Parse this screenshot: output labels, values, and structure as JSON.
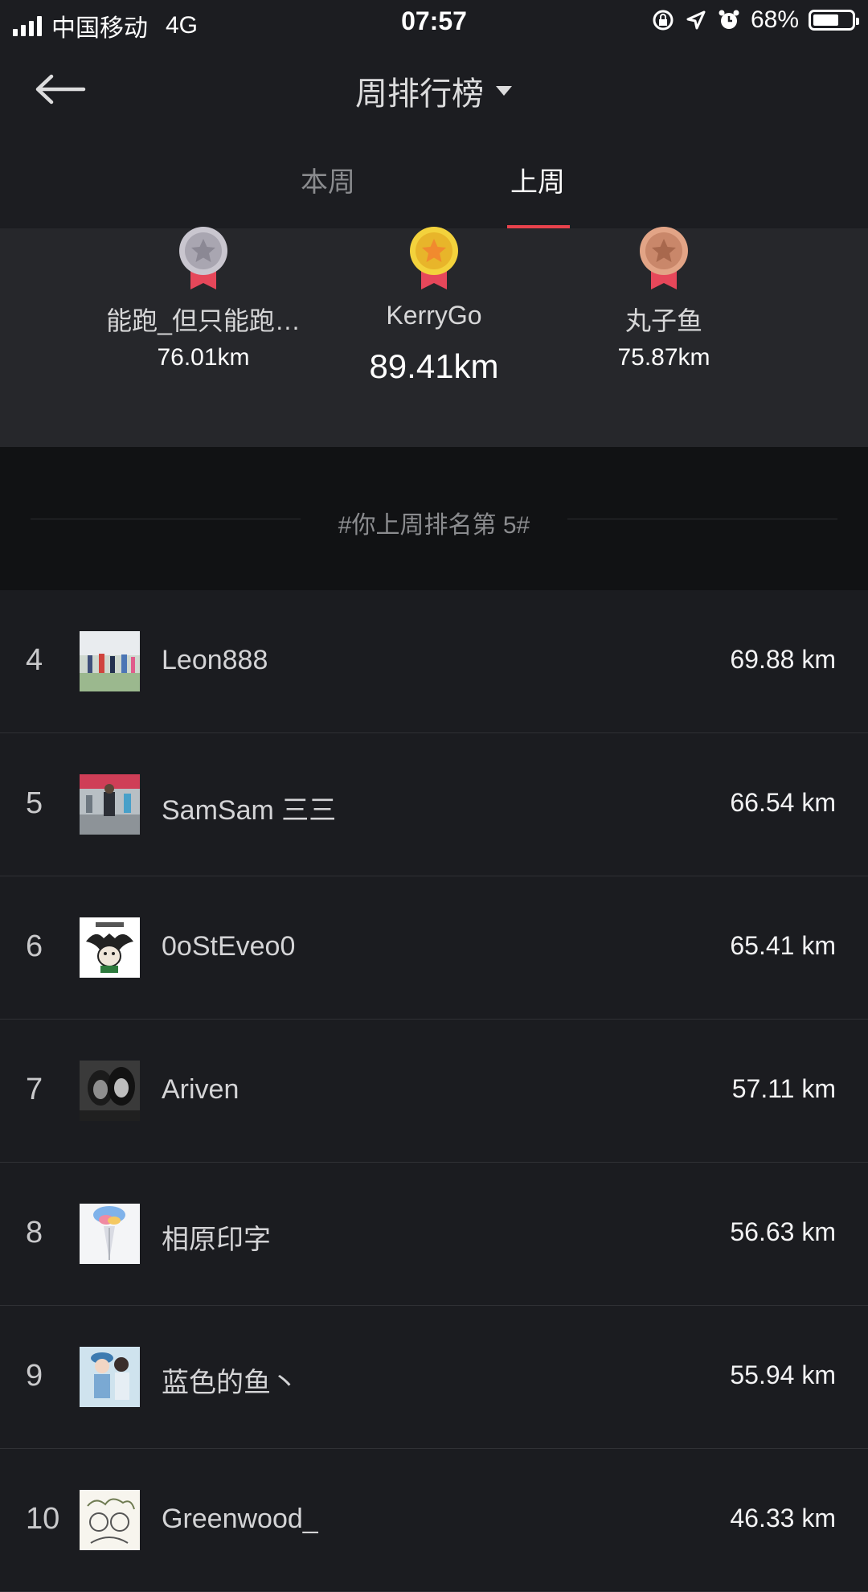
{
  "status_bar": {
    "carrier": "中国移动",
    "network": "4G",
    "time": "07:57",
    "battery": "68%",
    "battery_level": 0.68,
    "icons": [
      "signal-icon",
      "orientation-lock-icon",
      "location-icon",
      "alarm-icon",
      "battery-icon"
    ]
  },
  "header": {
    "title": "周排行榜",
    "back_icon": "arrow-left-icon",
    "dropdown_icon": "caret-down-icon"
  },
  "tabs": [
    {
      "label": "本周",
      "active": false
    },
    {
      "label": "上周",
      "active": true
    }
  ],
  "accent_color": "#e8424c",
  "podium": {
    "first": {
      "name": "KerryGo",
      "distance": "89.41km",
      "medal": "gold-medal-icon"
    },
    "second": {
      "name": "能跑_但只能跑…",
      "distance": "76.01km",
      "medal": "silver-medal-icon"
    },
    "third": {
      "name": "丸子鱼",
      "distance": "75.87km",
      "medal": "bronze-medal-icon"
    }
  },
  "rank_banner": "#你上周排名第 5#",
  "ranking": [
    {
      "rank": "4",
      "name": "Leon888",
      "distance": "69.88 km",
      "avatar": "race-photo-avatar"
    },
    {
      "rank": "5",
      "name": "SamSam 三三",
      "distance": "66.54 km",
      "avatar": "runner-photo-avatar"
    },
    {
      "rank": "6",
      "name": "0oStEveo0",
      "distance": "65.41 km",
      "avatar": "cartoon-avatar"
    },
    {
      "rank": "7",
      "name": "Ariven",
      "distance": "57.11 km",
      "avatar": "bw-portrait-avatar"
    },
    {
      "rank": "8",
      "name": "相原印字",
      "distance": "56.63 km",
      "avatar": "balloon-avatar"
    },
    {
      "rank": "9",
      "name": "蓝色的鱼丶",
      "distance": "55.94 km",
      "avatar": "girl-photo-avatar"
    },
    {
      "rank": "10",
      "name": "Greenwood_",
      "distance": "46.33 km",
      "avatar": "sketch-avatar"
    }
  ]
}
